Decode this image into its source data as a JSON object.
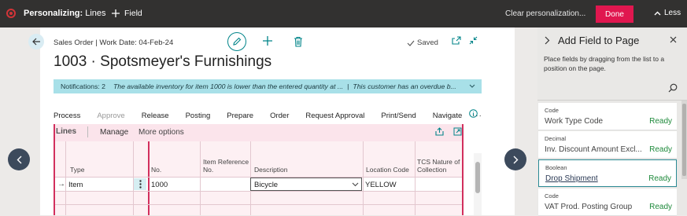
{
  "topbar": {
    "mode_prefix": "Personalizing:",
    "mode_target": "Lines",
    "field_label": "Field",
    "clear_label": "Clear personalization...",
    "done_label": "Done",
    "less_label": "Less"
  },
  "page": {
    "breadcrumb": "Sales Order | Work Date: 04-Feb-24",
    "title": "1003 · Spotsmeyer's Furnishings",
    "saved_label": "Saved",
    "notification": {
      "count_label": "Notifications: 2",
      "message1": "The available inventory for item 1000 is lower than the entered quantity at ...",
      "separator": "|",
      "message2": "This customer has an overdue b..."
    },
    "actions": [
      "Process",
      "Approve",
      "Release",
      "Posting",
      "Prepare",
      "Order",
      "Request Approval",
      "Print/Send",
      "Navigate"
    ],
    "more_actions": "···"
  },
  "lines": {
    "title": "Lines",
    "manage_label": "Manage",
    "more_options_label": "More options",
    "columns": {
      "type": "Type",
      "no": "No.",
      "item_ref_1": "Item Reference",
      "item_ref_2": "No.",
      "description": "Description",
      "location": "Location Code",
      "tcs_1": "TCS Nature of",
      "tcs_2": "Collection"
    },
    "row": {
      "type": "Item",
      "no": "1000",
      "description": "Bicycle",
      "location": "YELLOW"
    }
  },
  "panel": {
    "title": "Add Field to Page",
    "description": "Place fields by dragging from the list to a position on the page.",
    "fields": [
      {
        "type": "Code",
        "name": "Work Type Code",
        "status": "Ready"
      },
      {
        "type": "Decimal",
        "name": "Inv. Discount Amount Excl...",
        "status": "Ready"
      },
      {
        "type": "Boolean",
        "name": "Drop Shipment",
        "status": "Ready"
      },
      {
        "type": "Code",
        "name": "VAT Prod. Posting Group",
        "status": "Ready"
      }
    ]
  },
  "colors": {
    "topbar_bg": "#323130",
    "done_button": "#e0174f",
    "accent_teal": "#008489",
    "notification_bg": "#a8e0e8",
    "lines_border": "#d22f5d",
    "status_ready": "#1f8a3c"
  }
}
